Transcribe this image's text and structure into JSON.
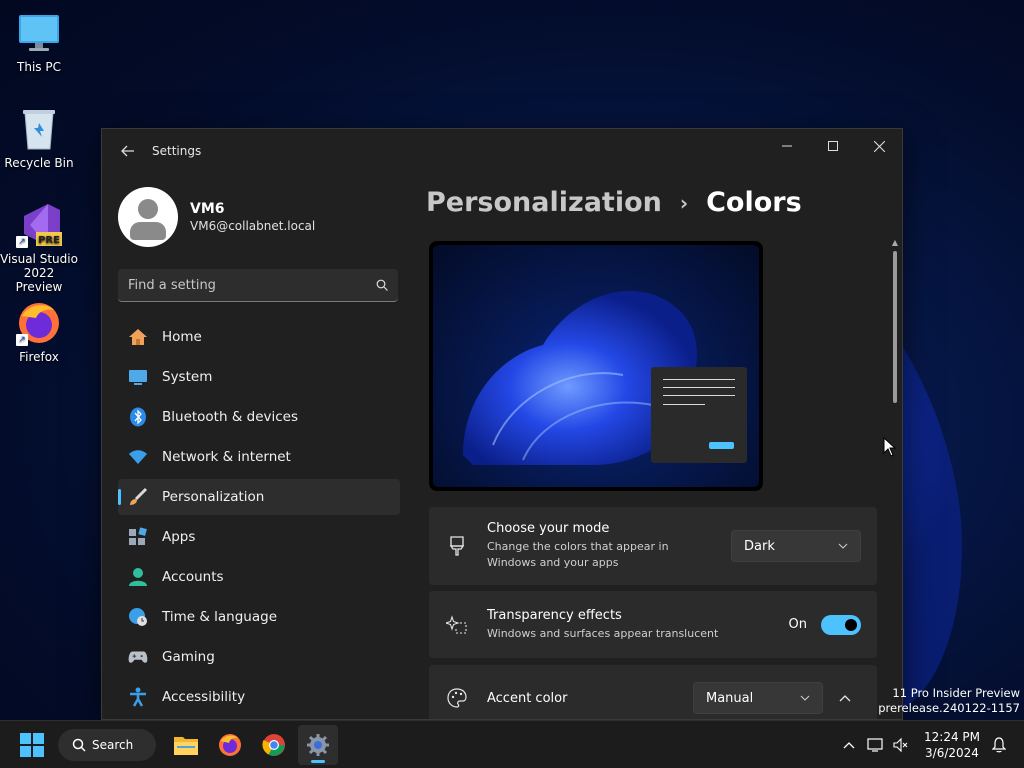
{
  "desktop": {
    "icons": [
      {
        "label": "This PC",
        "icon": "monitor-icon"
      },
      {
        "label": "Recycle Bin",
        "icon": "recycle-bin-icon"
      },
      {
        "label": "Visual Studio 2022 Preview",
        "icon": "visual-studio-icon",
        "badge": "PRE"
      },
      {
        "label": "Firefox",
        "icon": "firefox-icon"
      }
    ],
    "watermark_line1": "11 Pro Insider Preview",
    "watermark_line2": "prerelease.240122-1157"
  },
  "window": {
    "title": "Settings",
    "controls": {
      "minimize": "—",
      "maximize": "☐",
      "close": "✕"
    }
  },
  "profile": {
    "name": "VM6",
    "email": "VM6@collabnet.local"
  },
  "search": {
    "placeholder": "Find a setting"
  },
  "nav": {
    "items": [
      {
        "label": "Home",
        "icon": "home-icon"
      },
      {
        "label": "System",
        "icon": "system-icon"
      },
      {
        "label": "Bluetooth & devices",
        "icon": "bluetooth-icon"
      },
      {
        "label": "Network & internet",
        "icon": "wifi-icon"
      },
      {
        "label": "Personalization",
        "icon": "brush-icon",
        "active": true
      },
      {
        "label": "Apps",
        "icon": "apps-icon"
      },
      {
        "label": "Accounts",
        "icon": "accounts-icon"
      },
      {
        "label": "Time & language",
        "icon": "globe-clock-icon"
      },
      {
        "label": "Gaming",
        "icon": "gamepad-icon"
      },
      {
        "label": "Accessibility",
        "icon": "accessibility-icon"
      }
    ]
  },
  "breadcrumb": {
    "parent": "Personalization",
    "separator": "›",
    "current": "Colors"
  },
  "cards": {
    "mode": {
      "title": "Choose your mode",
      "desc_line1": "Change the colors that appear in",
      "desc_line2": "Windows and your apps",
      "value": "Dark"
    },
    "transparency": {
      "title": "Transparency effects",
      "desc": "Windows and surfaces appear translucent",
      "state_label": "On",
      "on": true
    },
    "accent": {
      "title": "Accent color",
      "value": "Manual"
    }
  },
  "taskbar": {
    "search_label": "Search",
    "apps": [
      "file-explorer-icon",
      "firefox-icon",
      "chrome-icon",
      "settings-icon"
    ],
    "time": "12:24 PM",
    "date": "3/6/2024"
  },
  "colors": {
    "accent": "#4cc2ff",
    "window_bg": "#202020",
    "card_bg": "#2b2b2b"
  }
}
